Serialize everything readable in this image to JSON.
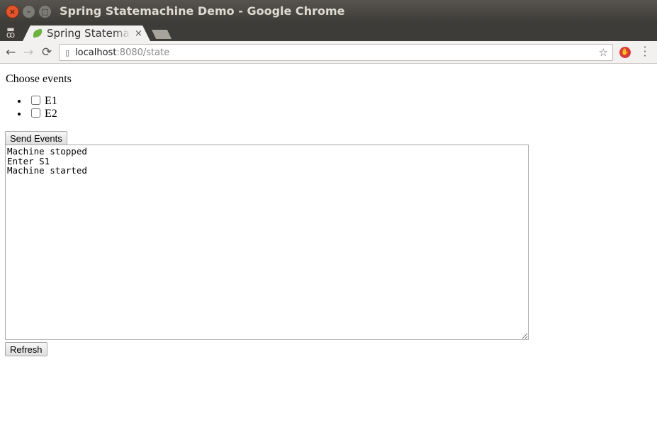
{
  "window": {
    "title": "Spring Statemachine Demo - Google Chrome",
    "close_glyph": "×",
    "minimize_glyph": "–",
    "maximize_glyph": "□"
  },
  "tabs": [
    {
      "title": "Spring Statemachine Demo",
      "close_glyph": "×",
      "favicon": "spring-leaf-icon",
      "active": true
    }
  ],
  "toolbar": {
    "back_glyph": "←",
    "forward_glyph": "→",
    "reload_glyph": "C",
    "url_host": "localhost",
    "url_path": ":8080/state",
    "bookmark_glyph": "☆",
    "page_icon_glyph": "🗋",
    "menu_glyph": "⋮",
    "incognito_glyph": "ꝏ"
  },
  "page": {
    "heading": "Choose events",
    "events": [
      {
        "label": "E1",
        "checked": false
      },
      {
        "label": "E2",
        "checked": false
      }
    ],
    "send_button": "Send Events",
    "log_text": "Machine stopped\nEnter S1\nMachine started",
    "refresh_button": "Refresh"
  },
  "colors": {
    "titlebar": "#3e3c38",
    "close_button": "#e2542b",
    "favicon": "#6db33f",
    "extension": "#d93a3a"
  }
}
